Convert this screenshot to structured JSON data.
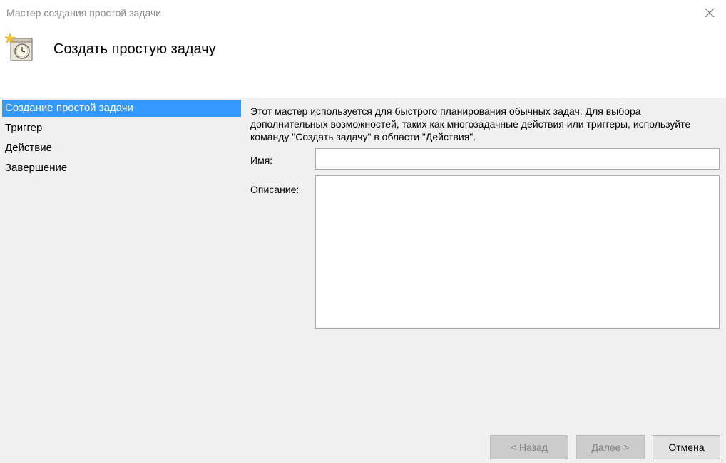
{
  "window": {
    "title": "Мастер создания простой задачи"
  },
  "header": {
    "title": "Создать простую задачу",
    "icon": "clock-calendar-wizard-icon"
  },
  "sidebar": {
    "steps": [
      {
        "label": "Создание простой задачи",
        "active": true
      },
      {
        "label": "Триггер",
        "active": false
      },
      {
        "label": "Действие",
        "active": false
      },
      {
        "label": "Завершение",
        "active": false
      }
    ]
  },
  "content": {
    "intro": "Этот мастер используется для быстрого планирования обычных задач.  Для выбора дополнительных возможностей, таких как многозадачные действия или триггеры, используйте команду \"Создать задачу\" в области \"Действия\".",
    "name_label": "Имя:",
    "name_value": "",
    "description_label": "Описание:",
    "description_value": ""
  },
  "buttons": {
    "back": "< Назад",
    "next": "Далее >",
    "cancel": "Отмена"
  },
  "colors": {
    "accent": "#3399ff",
    "background": "#f0f0f0"
  }
}
